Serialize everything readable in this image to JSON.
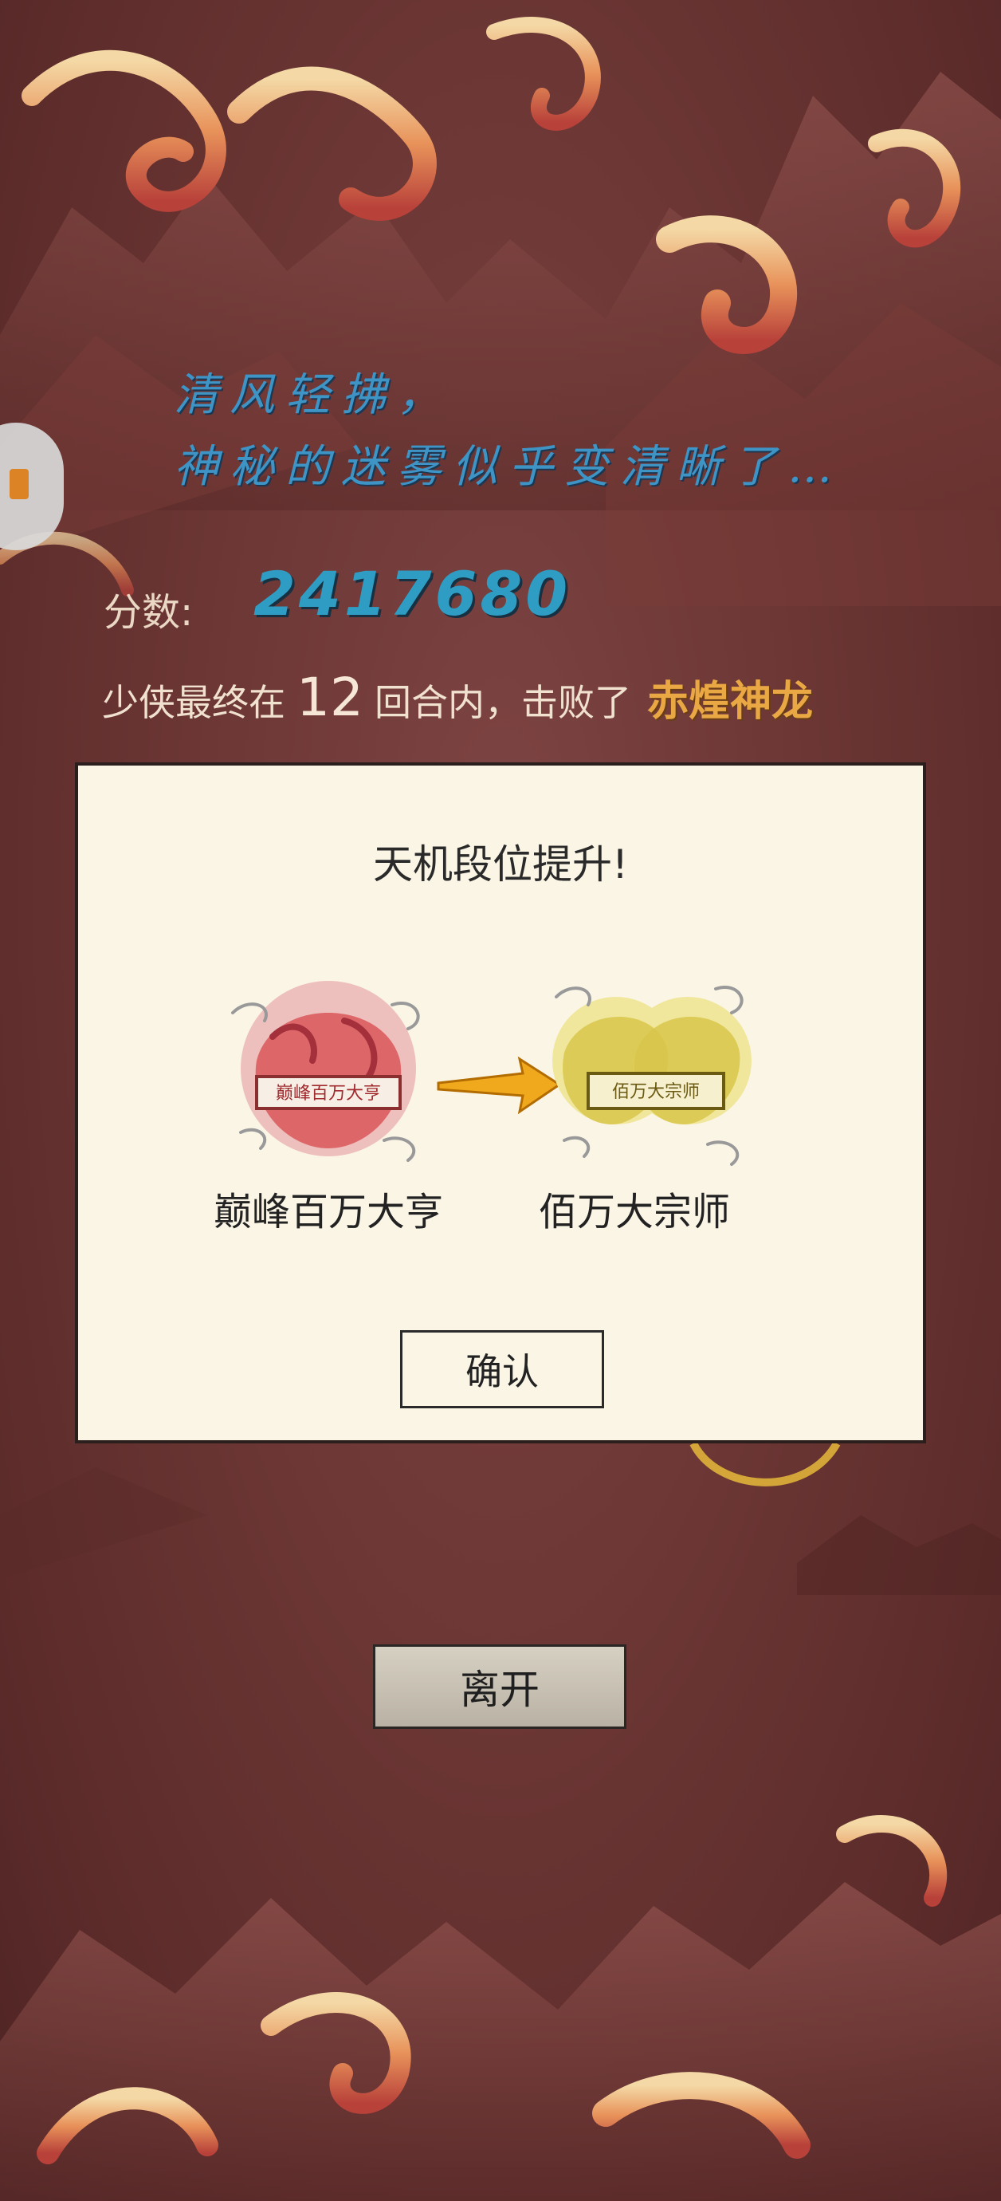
{
  "poem": {
    "line1": "清风轻拂，",
    "line2": "神秘的迷雾似乎变清晰了…"
  },
  "score": {
    "label": "分数:",
    "value": "2417680"
  },
  "result": {
    "prefix": "少侠最终在",
    "rounds": "12",
    "middle": "回合内，击败了",
    "boss": "赤煌神龙"
  },
  "dialog": {
    "title": "天机段位提升!",
    "old_rank": {
      "name": "巅峰百万大亨",
      "badge_text": "巅峰百万大亨",
      "color": "#d9565b"
    },
    "new_rank": {
      "name": "佰万大宗师",
      "badge_text": "佰万大宗师",
      "color": "#d8c64a"
    },
    "confirm_label": "确认"
  },
  "leave_label": "离开",
  "colors": {
    "background": "#6a3533",
    "poem_text": "#3f94c6",
    "score_value": "#2f9dc3",
    "boss_name": "#e9a844",
    "dialog_bg": "#fbf5e6"
  },
  "icons": {
    "side_tab": "side-tab-icon",
    "arrow": "arrow-right-icon"
  }
}
